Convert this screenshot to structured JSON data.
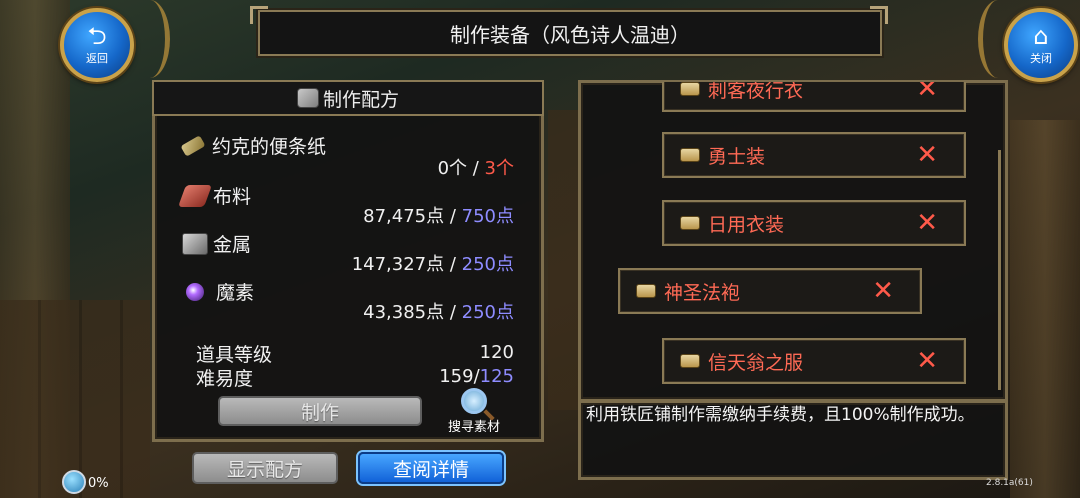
{
  "header": {
    "title": "制作装备（风色诗人温迪）"
  },
  "nav": {
    "back_label": "返回",
    "back_icon": "back-arrow-icon",
    "close_label": "关闭",
    "close_icon": "home-icon"
  },
  "recipe_panel": {
    "title": "制作配方",
    "materials": [
      {
        "name": "约克的便条纸",
        "icon": "note-icon",
        "have": "0个",
        "sep": " / ",
        "need": "3个",
        "need_color": "#ff5a4a"
      },
      {
        "name": "布料",
        "icon": "cloth-icon",
        "have": "87,475点",
        "sep": " / ",
        "need": "750点",
        "need_color": "#8e8cff"
      },
      {
        "name": "金属",
        "icon": "metal-icon",
        "have": "147,327点",
        "sep": " / ",
        "need": "250点",
        "need_color": "#8e8cff"
      },
      {
        "name": "魔素",
        "icon": "mana-orb-icon",
        "have": "43,385点",
        "sep": " / ",
        "need": "250点",
        "need_color": "#8e8cff"
      }
    ],
    "item_level_label": "道具等级",
    "item_level_value": "120",
    "difficulty_label": "难易度",
    "difficulty_value": "159/",
    "difficulty_max": "125",
    "craft_button": "制作",
    "search_label": "搜寻素材"
  },
  "footer_buttons": {
    "show_recipe": "显示配方",
    "view_details": "查阅详情"
  },
  "recipe_list": {
    "items": [
      {
        "label": "刺客夜行衣"
      },
      {
        "label": "勇士装"
      },
      {
        "label": "日用衣装"
      },
      {
        "label": "神圣法袍"
      },
      {
        "label": "信天翁之服"
      }
    ],
    "description": "利用铁匠铺制作需缴纳手续费，且100%制作成功。"
  },
  "status": {
    "percent": "0%",
    "version": "2.8.1a(61)"
  }
}
